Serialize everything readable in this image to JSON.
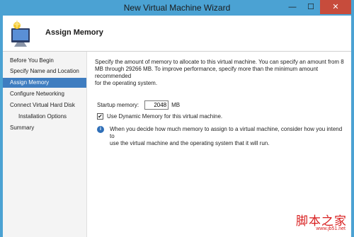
{
  "window": {
    "title": "New Virtual Machine Wizard",
    "controls": {
      "minimize": "—",
      "maximize": "☐",
      "close": "✕"
    }
  },
  "header": {
    "title": "Assign Memory",
    "icon": "virtual-machine-monitor-icon"
  },
  "sidebar": {
    "items": [
      {
        "label": "Before You Begin",
        "active": false,
        "indent": false
      },
      {
        "label": "Specify Name and Location",
        "active": false,
        "indent": false
      },
      {
        "label": "Assign Memory",
        "active": true,
        "indent": false
      },
      {
        "label": "Configure Networking",
        "active": false,
        "indent": false
      },
      {
        "label": "Connect Virtual Hard Disk",
        "active": false,
        "indent": false
      },
      {
        "label": "Installation Options",
        "active": false,
        "indent": true
      },
      {
        "label": "Summary",
        "active": false,
        "indent": false
      }
    ]
  },
  "content": {
    "description_lines": [
      "Specify the amount of memory to allocate to this virtual machine. You can specify an amount from 8",
      "MB through 29266 MB. To improve performance, specify more than the minimum amount recommended",
      "for the operating system."
    ],
    "startup_memory_label": "Startup memory:",
    "startup_memory_value": "2048",
    "startup_memory_unit": "MB",
    "dynamic_memory_label": "Use Dynamic Memory for this virtual machine.",
    "dynamic_memory_checked": true,
    "checkmark": "✔",
    "info_icon_glyph": "i",
    "info_lines": [
      "When you decide how much memory to assign to a virtual machine, consider how you intend to",
      "use the virtual machine and the operating system that it will run."
    ]
  },
  "watermark": {
    "chinese": "脚本之家",
    "url": "www.jb51.net"
  },
  "colors": {
    "titlebar": "#4ba2d3",
    "close_button": "#c74c3c",
    "active_nav": "#3f7dc0",
    "info_icon": "#2f6fb8",
    "watermark": "#d81e1e"
  }
}
